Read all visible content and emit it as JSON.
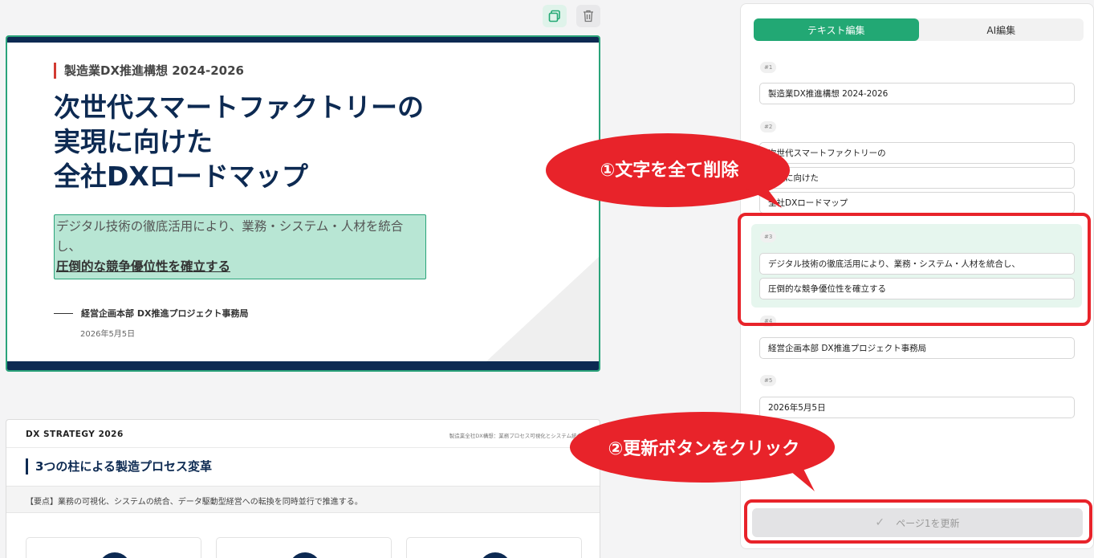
{
  "toolbar": {
    "copy_icon": "copy-icon",
    "trash_icon": "trash-icon"
  },
  "slide1": {
    "kicker": "製造業DX推進構想 2024-2026",
    "title_lines": [
      "次世代スマートファクトリーの",
      "実現に向けた",
      "全社DXロードマップ"
    ],
    "subtitle_line1": "デジタル技術の徹底活用により、業務・システム・人材を統合",
    "subtitle_line2": "し、",
    "subtitle_line3": "圧倒的な競争優位性を確立する",
    "department": "経営企画本部 DX推進プロジェクト事務局",
    "date": "2026年5月5日"
  },
  "slide2": {
    "brand": "DX STRATEGY 2026",
    "breadcrumb": "製造業全社DX構想：業務プロセス可視化とシステム統合",
    "title": "3つの柱による製造プロセス変革",
    "note": "【要点】業務の可視化、システムの統合、データ駆動型経営への転換を同時並行で推進する。"
  },
  "panel": {
    "tabs": {
      "text_edit": "テキスト編集",
      "ai_edit": "AI編集"
    },
    "sections": [
      {
        "badge": "#1",
        "fields": [
          "製造業DX推進構想 2024-2026"
        ]
      },
      {
        "badge": "#2",
        "fields": [
          "次世代スマートファクトリーの",
          "実現に向けた",
          "全社DXロードマップ"
        ]
      },
      {
        "badge": "#3",
        "fields": [
          "デジタル技術の徹底活用により、業務・システム・人材を統合し、",
          "圧倒的な競争優位性を確立する"
        ]
      },
      {
        "badge": "#4",
        "fields": [
          "経営企画本部 DX推進プロジェクト事務局"
        ]
      },
      {
        "badge": "#5",
        "fields": [
          "2026年5月5日"
        ]
      }
    ],
    "update_button": "ページ1を更新"
  },
  "annotations": {
    "callout1": "①文字を全て削除",
    "callout2": "②更新ボタンをクリック"
  },
  "colors": {
    "accent": "#22a874",
    "navy": "#0d2a52",
    "annotation_red": "#e8232a"
  }
}
